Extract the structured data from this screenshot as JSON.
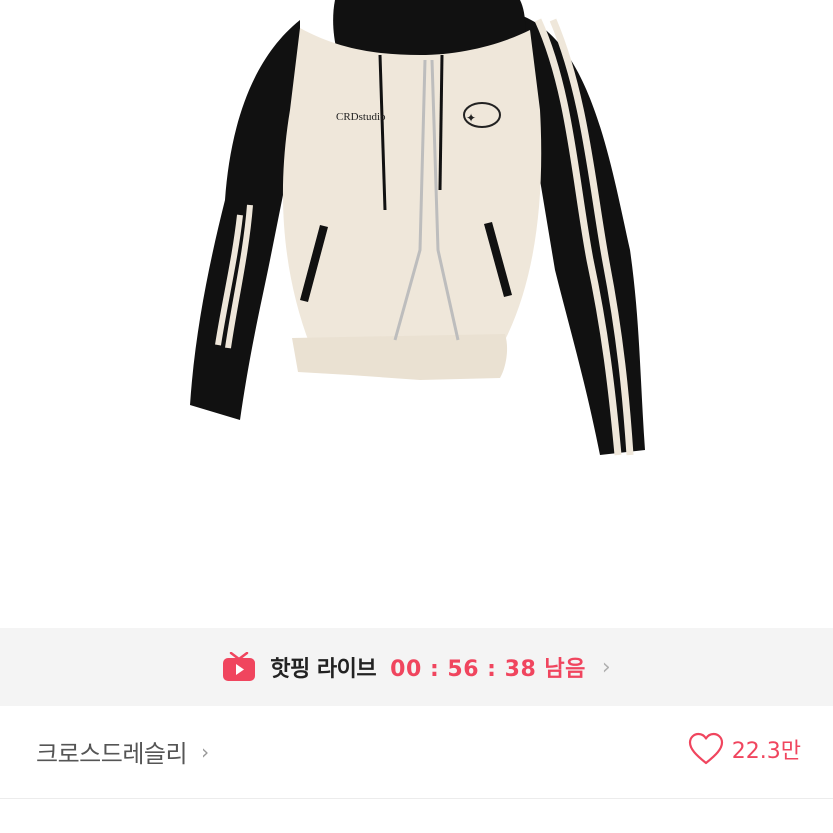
{
  "product": {
    "image_alt": "jacket-photo",
    "chest_text": "CRDstudio"
  },
  "live": {
    "icon": "tv-icon",
    "title": "핫핑 라이브",
    "timer": "00 : 56 : 38 남음",
    "chevron": "›",
    "accent_color": "#f0455e"
  },
  "shop": {
    "name": "크로스드레슬리",
    "chevron": "›"
  },
  "like": {
    "icon": "heart-outline-icon",
    "count": "22.3만"
  }
}
